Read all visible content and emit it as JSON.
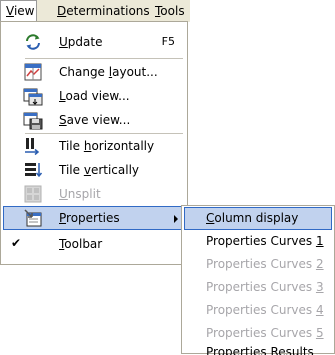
{
  "menubar": {
    "items": [
      {
        "pre": "",
        "acc": "V",
        "post": "iew"
      },
      {
        "pre": "",
        "acc": "D",
        "post": "eterminations"
      },
      {
        "pre": "",
        "acc": "T",
        "post": "ools"
      }
    ]
  },
  "view_menu": {
    "update": {
      "pre": "",
      "acc": "U",
      "post": "pdate",
      "shortcut": "F5",
      "icon": "update-arrows-icon"
    },
    "change_layout": {
      "pre": "Change ",
      "acc": "l",
      "post": "ayout...",
      "icon": "layout-icon"
    },
    "load_view": {
      "pre": "",
      "acc": "L",
      "post": "oad view...",
      "icon": "load-view-icon"
    },
    "save_view": {
      "pre": "",
      "acc": "S",
      "post": "ave view...",
      "icon": "save-view-icon"
    },
    "tile_h": {
      "pre": "Tile ",
      "acc": "h",
      "post": "orizontally",
      "icon": "tile-horizontal-icon"
    },
    "tile_v": {
      "pre": "Tile ",
      "acc": "v",
      "post": "ertically",
      "icon": "tile-vertical-icon"
    },
    "unsplit": {
      "pre": "",
      "acc": "U",
      "post": "nsplit",
      "icon": "unsplit-icon"
    },
    "properties": {
      "pre": "",
      "acc": "P",
      "post": "roperties",
      "icon": "properties-icon"
    },
    "toolbar": {
      "pre": "",
      "acc": "T",
      "post": "oolbar",
      "checked": "✔"
    }
  },
  "properties_submenu": {
    "items": [
      {
        "pre": "",
        "acc": "C",
        "post": "olumn display"
      },
      {
        "pre": "Properties Curves ",
        "acc": "1",
        "post": ""
      },
      {
        "pre": "Properties Curves ",
        "acc": "2",
        "post": ""
      },
      {
        "pre": "Properties Curves ",
        "acc": "3",
        "post": ""
      },
      {
        "pre": "Properties Curves ",
        "acc": "4",
        "post": ""
      },
      {
        "pre": "Properties Curves ",
        "acc": "5",
        "post": ""
      },
      {
        "pre": "Properties Results",
        "acc": "",
        "post": ""
      }
    ]
  },
  "colors": {
    "menubar_bg": "#ece9d8",
    "highlight_bg": "#c1d2ee",
    "highlight_border": "#316ac5",
    "disabled_text": "#a7a6aa"
  }
}
